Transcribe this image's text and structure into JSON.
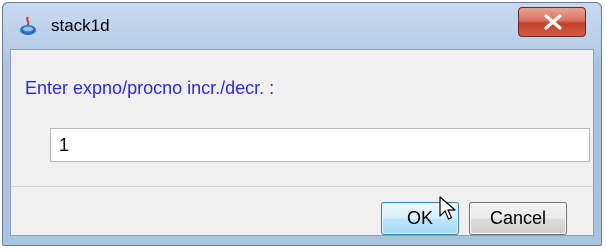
{
  "window": {
    "title": "stack1d",
    "app_icon": "java-app-icon",
    "close_icon": "close-icon"
  },
  "dialog": {
    "prompt": "Enter expno/procno incr./decr. :",
    "input_value": "1"
  },
  "buttons": {
    "ok_label": "OK",
    "cancel_label": "Cancel"
  },
  "colors": {
    "prompt_text": "#2a2ae6",
    "close_button": "#c5412c",
    "ok_button_border": "#3c7fb1",
    "title_bar": "#b7cde8"
  }
}
